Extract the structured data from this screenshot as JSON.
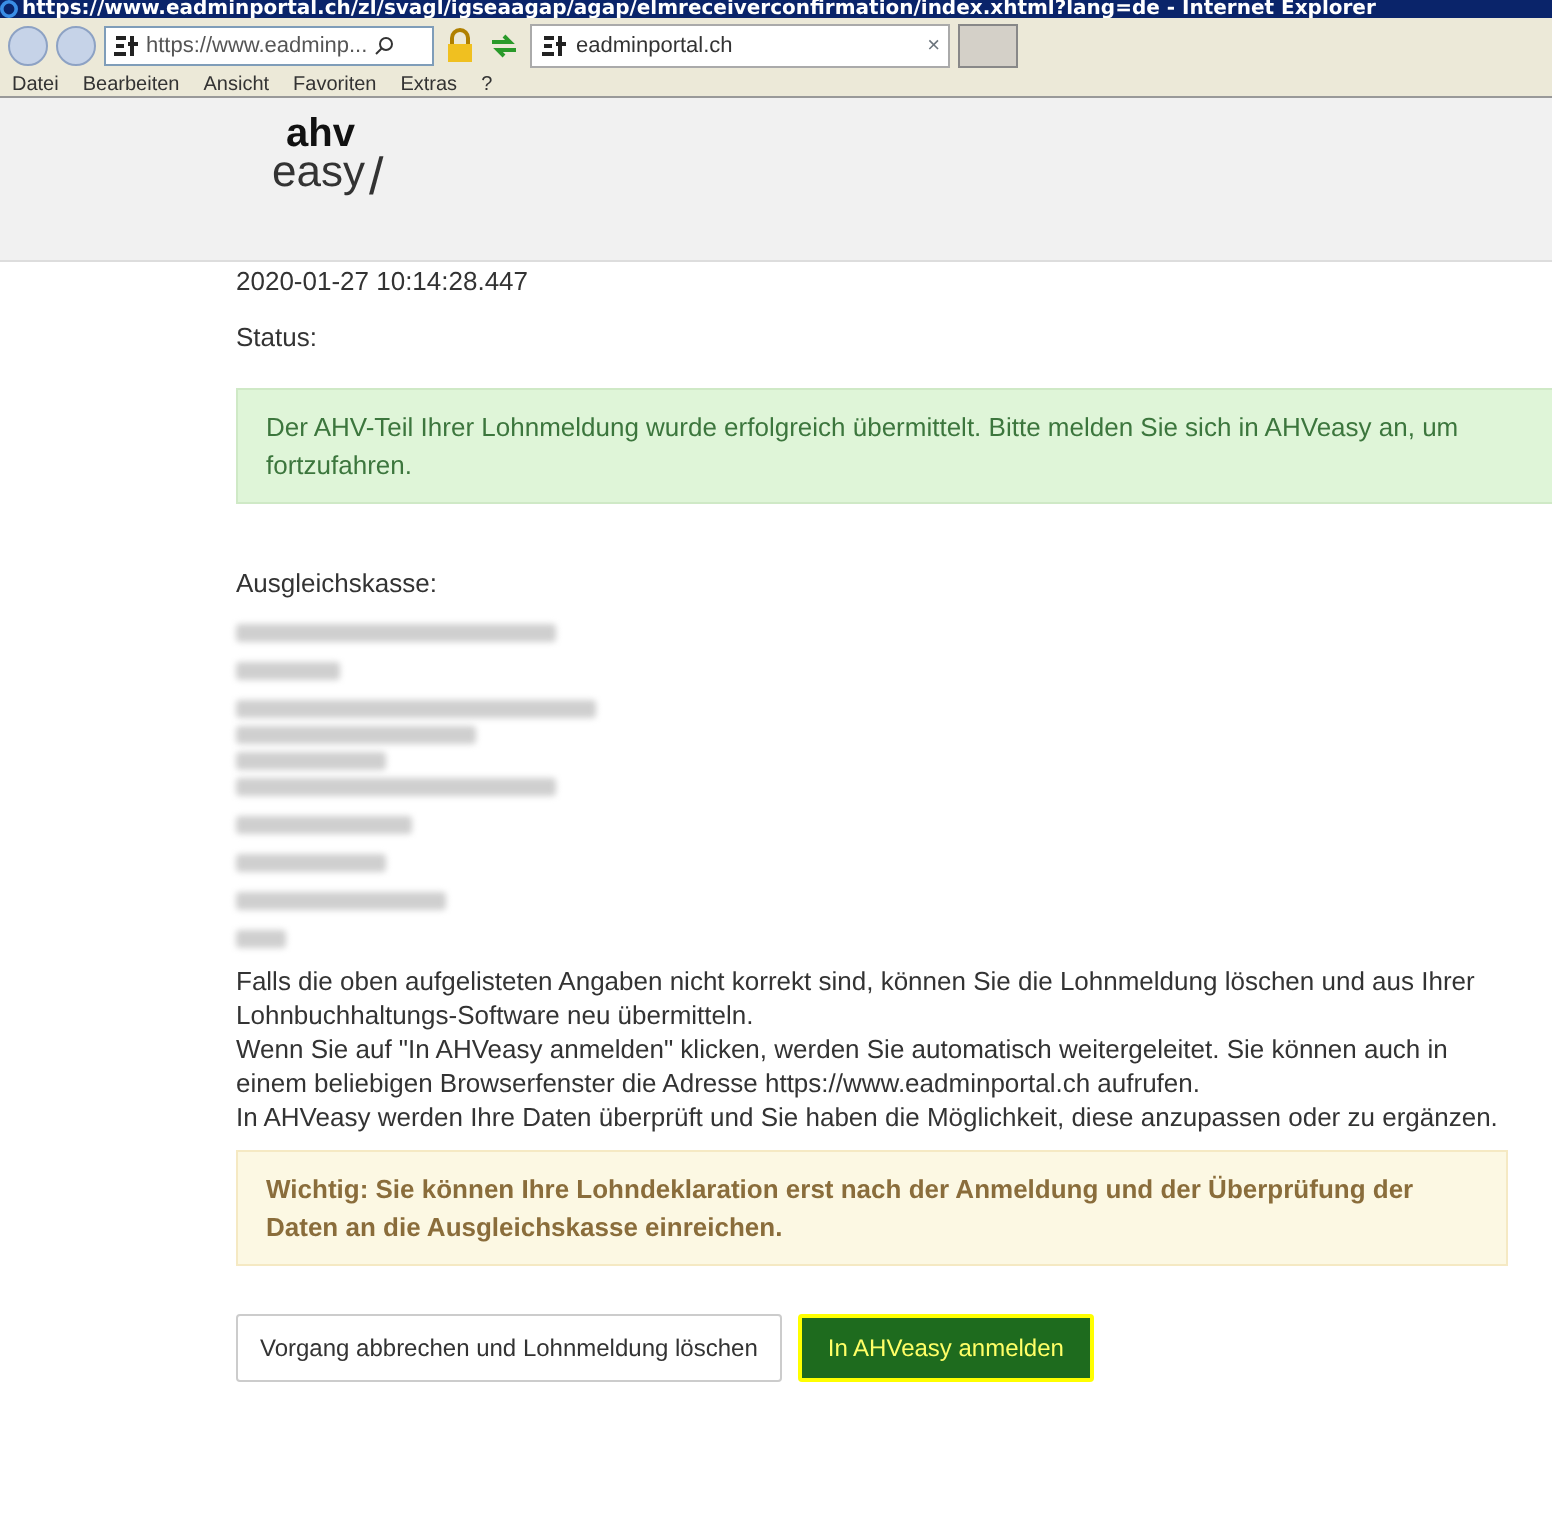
{
  "window": {
    "title": "https://www.eadminportal.ch/zl/svagl/igseaagap/agap/elmreceiverconfirmation/index.xhtml?lang=de - Internet Explorer"
  },
  "address_bar": {
    "url": "https://www.eadminp...",
    "tab_title": "eadminportal.ch",
    "tab_close": "×"
  },
  "menu": [
    "Datei",
    "Bearbeiten",
    "Ansicht",
    "Favoriten",
    "Extras",
    "?"
  ],
  "logo": {
    "top": "ahv",
    "bottom": "easy",
    "slash": "/"
  },
  "timestamp": "2020-01-27 10:14:28.447",
  "status_label": "Status:",
  "success_message": "Der AHV-Teil Ihrer Lohnmeldung wurde erfolgreich übermittelt. Bitte melden Sie sich in AHVeasy an, um fortzufahren.",
  "compensation_label": "Ausgleichskasse:",
  "redacted_groups": [
    [
      {
        "blurred": true
      }
    ],
    [
      {
        "blurred": true
      }
    ],
    [
      {
        "blurred": true
      },
      {
        "blurred": true
      },
      {
        "blurred": true
      },
      {
        "blurred": true
      }
    ],
    [
      {
        "blurred": true
      }
    ],
    [
      {
        "blurred": true
      }
    ],
    [
      {
        "blurred": true
      }
    ],
    [
      {
        "blurred": true
      }
    ]
  ],
  "info_lines": [
    "Falls die oben aufgelisteten Angaben nicht korrekt sind, können Sie die Lohnmeldung löschen und aus Ihrer Lohnbuchhaltungs-Software neu übermitteln.",
    "Wenn Sie auf \"In AHVeasy anmelden\" klicken, werden Sie automatisch weitergeleitet. Sie können auch in einem beliebigen Browserfenster die Adresse https://www.eadminportal.ch aufrufen.",
    "In AHVeasy werden Ihre Daten überprüft und Sie haben die Möglichkeit, diese anzupassen oder zu ergänzen."
  ],
  "warning_message": "Wichtig: Sie können Ihre Lohndeklaration erst nach der Anmeldung und der Überprüfung der Daten an die Ausgleichskasse einreichen.",
  "buttons": [
    {
      "label": "Vorgang abbrechen und Lohnmeldung löschen",
      "kind": "secondary"
    },
    {
      "label": "In AHVeasy anmelden",
      "kind": "primary"
    }
  ]
}
